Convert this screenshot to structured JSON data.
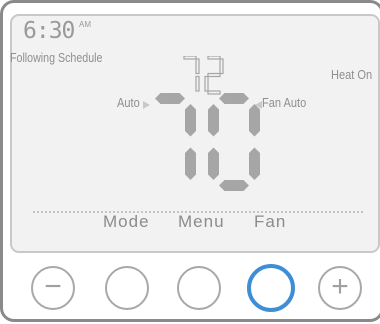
{
  "display": {
    "time": "6:30",
    "ampm": "AM",
    "schedule_status": "Following Schedule",
    "system_status": "Heat On",
    "mode_indicator": "Auto",
    "fan_indicator": "Fan Auto",
    "set_temperature": "72",
    "current_temperature": "70"
  },
  "softkeys": {
    "mode_label": "Mode",
    "menu_label": "Menu",
    "fan_label": "Fan"
  },
  "buttons": {
    "minus_glyph": "−",
    "plus_glyph": "+"
  },
  "colors": {
    "active_button": "#3f8dd4",
    "segment": "#a6a6a6",
    "screen_background": "#f2f2f2"
  },
  "icons": [
    "minus-icon",
    "plus-icon"
  ]
}
